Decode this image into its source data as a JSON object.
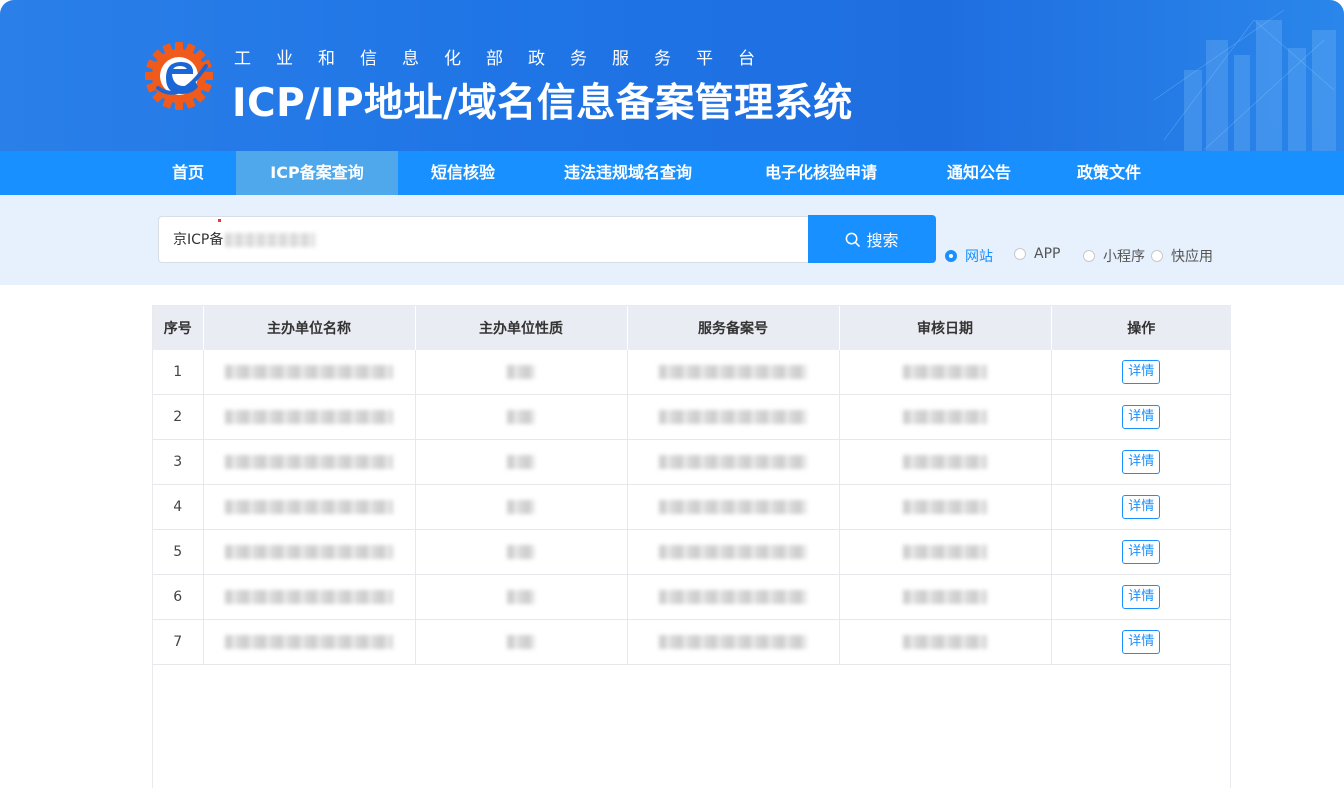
{
  "header": {
    "subtitle": "工业和信息化部政务服务平台",
    "title": "ICP/IP地址/域名信息备案管理系统"
  },
  "nav": {
    "items": [
      {
        "label": "首页"
      },
      {
        "label": "ICP备案查询",
        "active": true
      },
      {
        "label": "短信核验"
      },
      {
        "label": "违法违规域名查询"
      },
      {
        "label": "电子化核验申请"
      },
      {
        "label": "通知公告"
      },
      {
        "label": "政策文件"
      }
    ]
  },
  "search": {
    "value": "京ICP备",
    "button_label": "搜索",
    "types": [
      {
        "label": "网站",
        "checked": true
      },
      {
        "label": "APP"
      },
      {
        "label": "小程序"
      },
      {
        "label": "快应用"
      }
    ]
  },
  "table": {
    "columns": [
      "序号",
      "主办单位名称",
      "主办单位性质",
      "服务备案号",
      "审核日期",
      "操作"
    ],
    "rows": [
      {
        "index": "1",
        "action": "详情"
      },
      {
        "index": "2",
        "action": "详情"
      },
      {
        "index": "3",
        "action": "详情"
      },
      {
        "index": "4",
        "action": "详情"
      },
      {
        "index": "5",
        "action": "详情"
      },
      {
        "index": "6",
        "action": "详情"
      },
      {
        "index": "7",
        "action": "详情"
      }
    ]
  },
  "colors": {
    "primary": "#1890ff",
    "header_bg": "#1f74e6",
    "nav_active": "#50a8ec",
    "search_band": "#e6f1fd",
    "logo_orange": "#f05a1a"
  }
}
